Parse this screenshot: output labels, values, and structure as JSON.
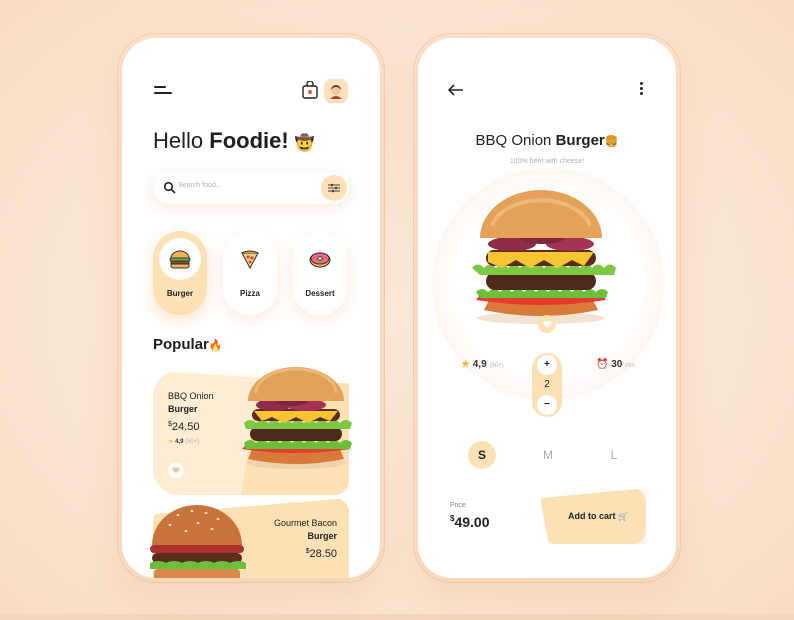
{
  "home": {
    "greeting_plain": "Hello",
    "greeting_bold": "Foodie!",
    "greeting_emoji": "🤠",
    "search_placeholder": "Search food...",
    "categories": [
      {
        "label": "Burger",
        "icon": "burger-icon",
        "active": true
      },
      {
        "label": "Pizza",
        "icon": "pizza-icon",
        "active": false
      },
      {
        "label": "Dessert",
        "icon": "donut-icon",
        "active": false
      }
    ],
    "popular_label": "Popular",
    "popular_emoji": "🔥",
    "items": [
      {
        "name_line1": "BBQ Onion",
        "name_line2": "Burger",
        "currency": "$",
        "price": "24.50",
        "rating": "4,9",
        "rating_count": "(50+)"
      },
      {
        "name_line1": "Gourmet Bacon",
        "name_line2": "Burger",
        "currency": "$",
        "price": "28.50"
      }
    ]
  },
  "detail": {
    "title_plain": "BBQ Onion",
    "title_bold": "Burger",
    "title_emoji": "🍔",
    "subtitle": "100% beef with cheese!",
    "rating": "4,9",
    "rating_count": "(50+)",
    "quantity": "2",
    "plus_label": "+",
    "minus_label": "−",
    "time_value": "30",
    "time_unit": "min",
    "sizes": [
      "S",
      "M",
      "L"
    ],
    "selected_size": "S",
    "price_label": "Price",
    "currency": "$",
    "price": "49.00",
    "cart_label": "Add to cart",
    "cart_emoji": "🛒"
  },
  "colors": {
    "accent": "#fde1b6",
    "background": "#fbe7d4",
    "text": "#222222",
    "muted": "#b9b2ab"
  }
}
